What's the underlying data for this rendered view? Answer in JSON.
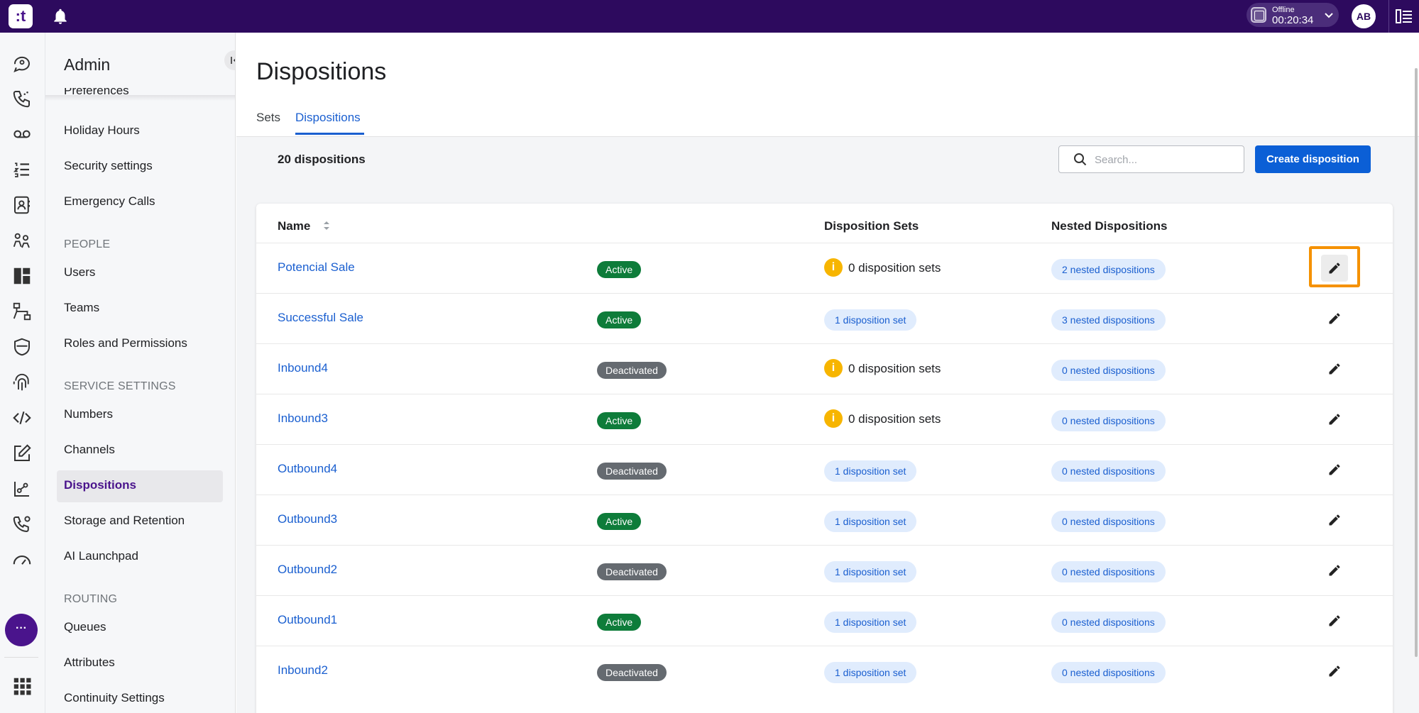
{
  "topbar": {
    "logo_text": ":t",
    "status": {
      "label": "Offline",
      "time": "00:20:34"
    },
    "avatar_initials": "AB"
  },
  "rail": {
    "icons": [
      "conversations-icon",
      "calls-icon",
      "voicemail-icon",
      "task-list-icon",
      "contacts-icon",
      "team-icon",
      "dashboard-icon",
      "routing-flow-icon",
      "security-shield-icon",
      "fingerprint-icon",
      "code-icon",
      "edit-note-icon",
      "analytics-icon",
      "phone-settings-icon",
      "speedometer-icon"
    ],
    "more_label": "···",
    "apps_icon": "apps-grid-icon"
  },
  "adminnav": {
    "title": "Admin",
    "partial_item": "Preferences",
    "items_top": [
      {
        "label": "Holiday Hours"
      },
      {
        "label": "Security settings"
      },
      {
        "label": "Emergency Calls"
      }
    ],
    "section_people": "PEOPLE",
    "items_people": [
      {
        "label": "Users"
      },
      {
        "label": "Teams"
      },
      {
        "label": "Roles and Permissions"
      }
    ],
    "section_service": "SERVICE SETTINGS",
    "items_service": [
      {
        "label": "Numbers"
      },
      {
        "label": "Channels"
      },
      {
        "label": "Dispositions"
      },
      {
        "label": "Storage and Retention"
      },
      {
        "label": "AI Launchpad"
      }
    ],
    "section_routing": "ROUTING",
    "items_routing": [
      {
        "label": "Queues"
      },
      {
        "label": "Attributes"
      },
      {
        "label": "Continuity Settings"
      }
    ]
  },
  "main": {
    "title": "Dispositions",
    "tabs": [
      {
        "label": "Sets"
      },
      {
        "label": "Dispositions"
      }
    ],
    "count_label": "20 dispositions",
    "search_placeholder": "Search...",
    "create_button": "Create disposition",
    "table": {
      "headers": {
        "name": "Name",
        "sets": "Disposition Sets",
        "nested": "Nested Dispositions"
      },
      "rows": [
        {
          "name": "Potencial Sale",
          "status": "Active",
          "sets": "0 disposition sets",
          "sets_warning": true,
          "nested": "2 nested dispositions"
        },
        {
          "name": "Successful Sale",
          "status": "Active",
          "sets": "1 disposition set",
          "sets_warning": false,
          "nested": "3 nested dispositions"
        },
        {
          "name": "Inbound4",
          "status": "Deactivated",
          "sets": "0 disposition sets",
          "sets_warning": true,
          "nested": "0 nested dispositions"
        },
        {
          "name": "Inbound3",
          "status": "Active",
          "sets": "0 disposition sets",
          "sets_warning": true,
          "nested": "0 nested dispositions"
        },
        {
          "name": "Outbound4",
          "status": "Deactivated",
          "sets": "1 disposition set",
          "sets_warning": false,
          "nested": "0 nested dispositions"
        },
        {
          "name": "Outbound3",
          "status": "Active",
          "sets": "1 disposition set",
          "sets_warning": false,
          "nested": "0 nested dispositions"
        },
        {
          "name": "Outbound2",
          "status": "Deactivated",
          "sets": "1 disposition set",
          "sets_warning": false,
          "nested": "0 nested dispositions"
        },
        {
          "name": "Outbound1",
          "status": "Active",
          "sets": "1 disposition set",
          "sets_warning": false,
          "nested": "0 nested dispositions"
        },
        {
          "name": "Inbound2",
          "status": "Deactivated",
          "sets": "1 disposition set",
          "sets_warning": false,
          "nested": "0 nested dispositions"
        }
      ]
    }
  },
  "colors": {
    "topbar": "#2d0a5e",
    "brand_purple": "#4a148c",
    "link_blue": "#1a5fd0",
    "primary_button": "#0b5fd6",
    "active_badge": "#0e7c3a",
    "deactivated_badge": "#656a70",
    "warning": "#f7b500",
    "highlight": "#f59100"
  }
}
